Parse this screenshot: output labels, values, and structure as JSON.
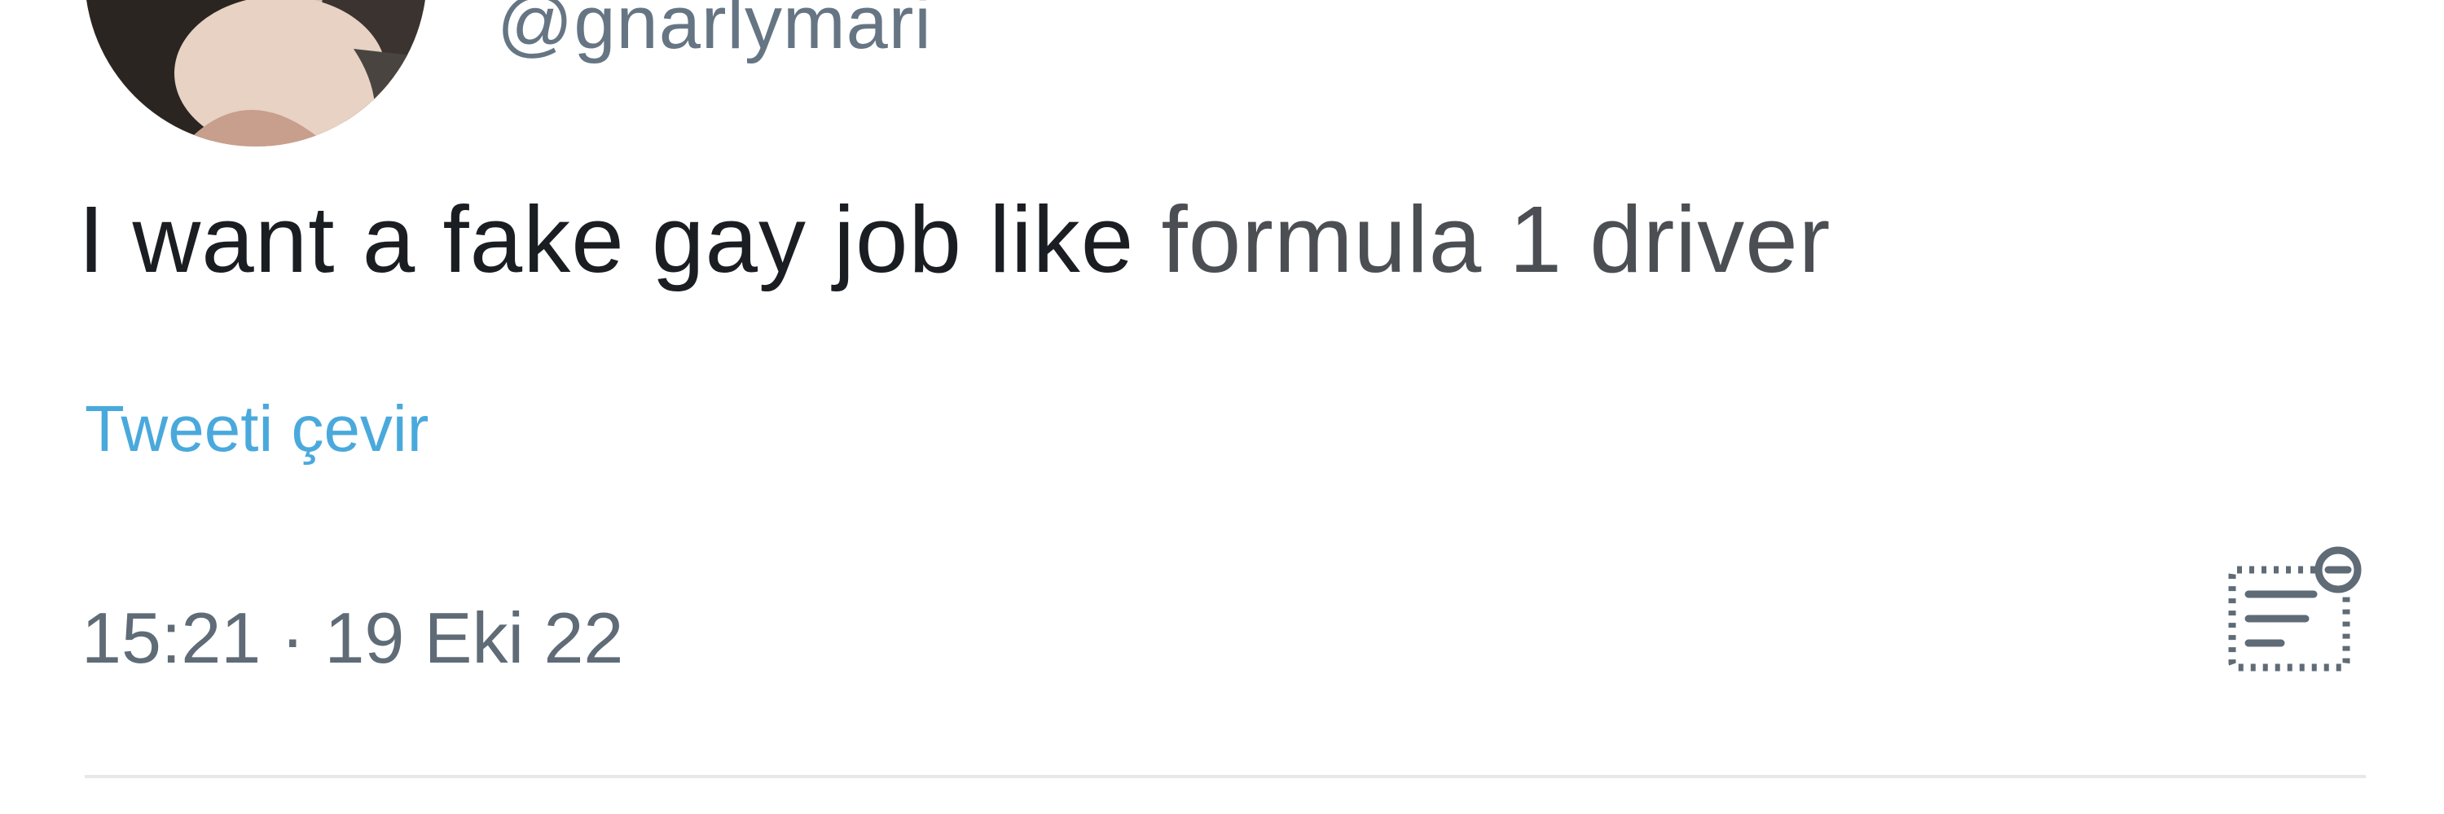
{
  "tweet": {
    "handle": "@gnarlymari",
    "text_main": "I want a fake gay job like ",
    "text_tail": "formula 1 driver",
    "translate_label": "Tweeti çevir",
    "time": "15:21",
    "separator": "·",
    "date": "19 Eki 22"
  },
  "icons": {
    "avatar": "profile-photo",
    "analytics": "view-analytics-icon"
  },
  "colors": {
    "text": "#1a1e22",
    "secondary": "#667583",
    "link": "#4aa9dc",
    "divider": "#e6e8ea"
  }
}
